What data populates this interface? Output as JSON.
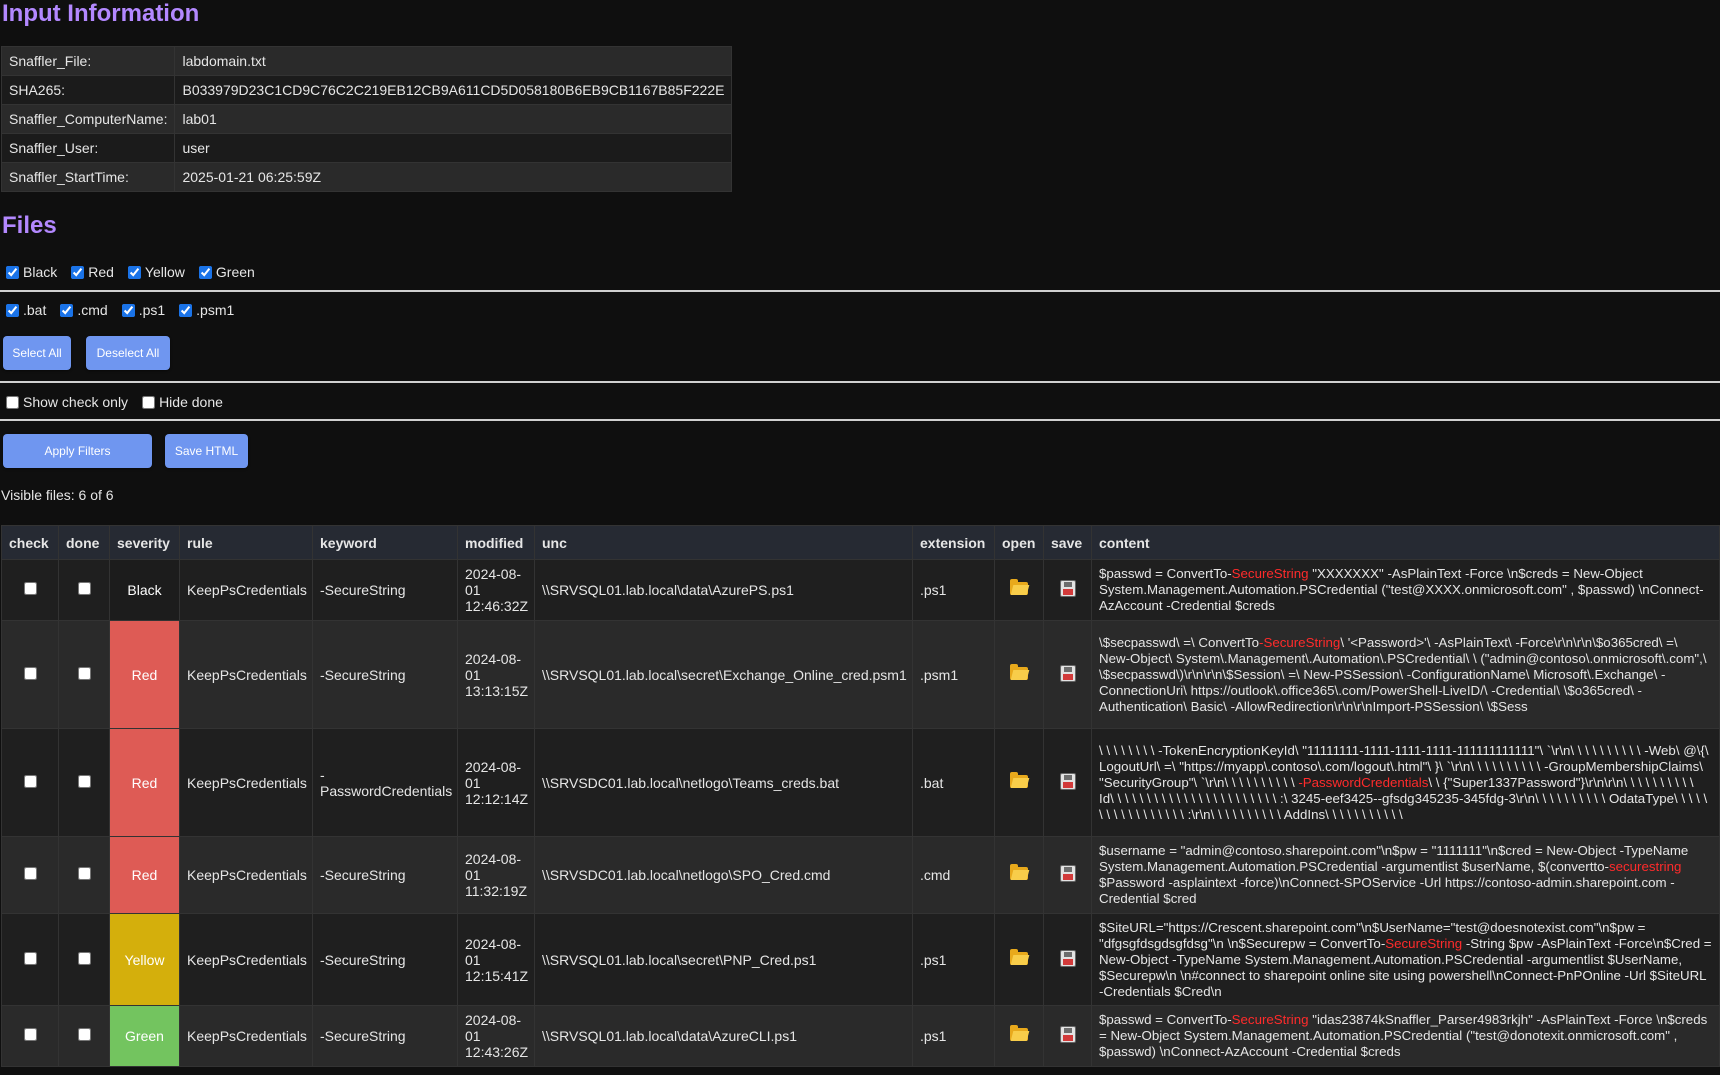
{
  "input_section": {
    "title": "Input Information",
    "rows": [
      {
        "key": "Snaffler_File:",
        "value": "labdomain.txt"
      },
      {
        "key": "SHA265:",
        "value": "B033979D23C1CD9C76C2C219EB12CB9A611CD5D058180B6EB9CB1167B85F222E"
      },
      {
        "key": "Snaffler_ComputerName:",
        "value": "lab01"
      },
      {
        "key": "Snaffler_User:",
        "value": "user"
      },
      {
        "key": "Snaffler_StartTime:",
        "value": "2025-01-21 06:25:59Z"
      }
    ]
  },
  "files_section": {
    "title": "Files",
    "severity_filters": [
      {
        "label": "Black",
        "checked": true
      },
      {
        "label": "Red",
        "checked": true
      },
      {
        "label": "Yellow",
        "checked": true
      },
      {
        "label": "Green",
        "checked": true
      }
    ],
    "extension_filters": [
      {
        "label": ".bat",
        "checked": true
      },
      {
        "label": ".cmd",
        "checked": true
      },
      {
        "label": ".ps1",
        "checked": true
      },
      {
        "label": ".psm1",
        "checked": true
      }
    ],
    "select_all_label": "Select All",
    "deselect_all_label": "Deselect All",
    "show_check_only_label": "Show check only",
    "hide_done_label": "Hide done",
    "apply_filters_label": "Apply Filters",
    "save_html_label": "Save HTML",
    "visible_count": "Visible files: 6 of 6"
  },
  "table": {
    "headers": [
      "check",
      "done",
      "severity",
      "rule",
      "keyword",
      "modified",
      "unc",
      "extension",
      "open",
      "save",
      "content"
    ],
    "rows": [
      {
        "severity": "Black",
        "severity_color": "#1c1c1c",
        "rule": "KeepPsCredentials",
        "keyword": "-SecureString",
        "modified": "2024-08-01 12:46:32Z",
        "unc": "\\\\SRVSQL01.lab.local\\data\\AzurePS.ps1",
        "extension": ".ps1",
        "content_before": "$passwd = ConvertTo-",
        "content_hl": "SecureString",
        "content_after": " \"XXXXXXX\" -AsPlainText -Force \\n$creds = New-Object System.Management.Automation.PSCredential (\"test@XXXX.onmicrosoft.com\" , $passwd) \\nConnect-AzAccount -Credential $creds"
      },
      {
        "severity": "Red",
        "severity_color": "#de5b55",
        "rule": "KeepPsCredentials",
        "keyword": "-SecureString",
        "modified": "2024-08-01 13:13:15Z",
        "unc": "\\\\SRVSQL01.lab.local\\secret\\Exchange_Online_cred.psm1",
        "extension": ".psm1",
        "content_before": "\\$secpasswd\\ =\\ ConvertTo",
        "content_hl": "-SecureString",
        "content_after": "\\ '<Password>'\\ -AsPlainText\\ -Force\\r\\n\\r\\n\\$o365cred\\ =\\ New-Object\\ System\\.Management\\.Automation\\.PSCredential\\ \\ (\"admin@contoso\\.onmicrosoft\\.com\",\\ \\$secpasswd\\)\\r\\n\\r\\n\\$Session\\ =\\ New-PSSession\\ -ConfigurationName\\ Microsoft\\.Exchange\\ -ConnectionUri\\ https://outlook\\.office365\\.com/PowerShell-LiveID/\\ -Credential\\ \\$o365cred\\ -Authentication\\ Basic\\ -AllowRedirection\\r\\n\\r\\nImport-PSSession\\ \\$Sess"
      },
      {
        "severity": "Red",
        "severity_color": "#de5b55",
        "rule": "KeepPsCredentials",
        "keyword": "-PasswordCredentials",
        "modified": "2024-08-01 12:12:14Z",
        "unc": "\\\\SRVSDC01.lab.local\\netlogo\\Teams_creds.bat",
        "extension": ".bat",
        "content_before": "\\ \\ \\ \\ \\ \\ \\ \\ -TokenEncryptionKeyId\\ \"11111111-1111-1111-1111-111111111111\"\\ `\\r\\n\\ \\ \\ \\ \\ \\ \\ \\ \\ \\ -Web\\ @\\{\\ LogoutUrl\\ =\\ \"https://myapp\\.contoso\\.com/logout\\.html\"\\ }\\ `\\r\\n\\ \\ \\ \\ \\ \\ \\ \\ \\ \\ -GroupMembershipClaims\\ \"SecurityGroup\"\\ `\\r\\n\\ \\ \\ \\ \\ \\ \\ \\ \\ \\ ",
        "content_hl": "-PasswordCredentials",
        "content_after": "\\ \\ {\"Super1337Password\"}\\r\\n\\r\\n\\ \\ \\ \\ \\ \\ \\ \\ \\ \\ Id\\ \\ \\ \\ \\ \\ \\ \\ \\ \\ \\ \\ \\ \\ \\ \\ \\ \\ \\ \\ \\ \\ \\ :\\ 3245-eef3425--gfsdg345235-345fdg-3\\r\\n\\ \\ \\ \\ \\ \\ \\ \\ \\ \\ OdataType\\ \\ \\ \\ \\ \\ \\ \\ \\ \\ \\ \\ \\ \\ \\ \\ \\ :\\r\\n\\ \\ \\ \\ \\ \\ \\ \\ \\ \\ AddIns\\ \\ \\ \\ \\ \\ \\ \\ \\ \\ \\"
      },
      {
        "severity": "Red",
        "severity_color": "#de5b55",
        "rule": "KeepPsCredentials",
        "keyword": "-SecureString",
        "modified": "2024-08-01 11:32:19Z",
        "unc": "\\\\SRVSDC01.lab.local\\netlogo\\SPO_Cred.cmd",
        "extension": ".cmd",
        "content_before": "$username = \"admin@contoso.sharepoint.com\"\\n$pw = \"1111111\"\\n$cred = New-Object -TypeName System.Management.Automation.PSCredential -argumentlist $userName, $(convertto-",
        "content_hl": "securestring",
        "content_after": " $Password -asplaintext -force)\\nConnect-SPOService -Url https://contoso-admin.sharepoint.com -Credential $cred"
      },
      {
        "severity": "Yellow",
        "severity_color": "#d4af0c",
        "rule": "KeepPsCredentials",
        "keyword": "-SecureString",
        "modified": "2024-08-01 12:15:41Z",
        "unc": "\\\\SRVSQL01.lab.local\\secret\\PNP_Cred.ps1",
        "extension": ".ps1",
        "content_before": "$SiteURL=\"https://Crescent.sharepoint.com\"\\n$UserName=\"test@doesnotexist.com\"\\n$pw = \"dfgsgfdsgdsgfdsg\"\\n \\n$Securepw = ConvertTo-",
        "content_hl": "SecureString",
        "content_after": " -String $pw -AsPlainText -Force\\n$Cred = New-Object -TypeName System.Management.Automation.PSCredential -argumentlist $UserName, $Securepw\\n \\n#connect to sharepoint online site using powershell\\nConnect-PnPOnline -Url $SiteURL -Credentials $Cred\\n"
      },
      {
        "severity": "Green",
        "severity_color": "#73c45f",
        "rule": "KeepPsCredentials",
        "keyword": "-SecureString",
        "modified": "2024-08-01 12:43:26Z",
        "unc": "\\\\SRVSQL01.lab.local\\data\\AzureCLI.ps1",
        "extension": ".ps1",
        "content_before": "$passwd = ConvertTo-",
        "content_hl": "SecureString",
        "content_after": " \"idas23874kSnaffler_Parser4983rkjh\" -AsPlainText -Force \\n$creds = New-Object System.Management.Automation.PSCredential (\"test@donotexit.onmicrosoft.com\" , $passwd) \\nConnect-AzAccount -Credential $creds"
      }
    ]
  },
  "icons": {
    "open": "folder-icon",
    "save": "floppy-disk-icon"
  }
}
